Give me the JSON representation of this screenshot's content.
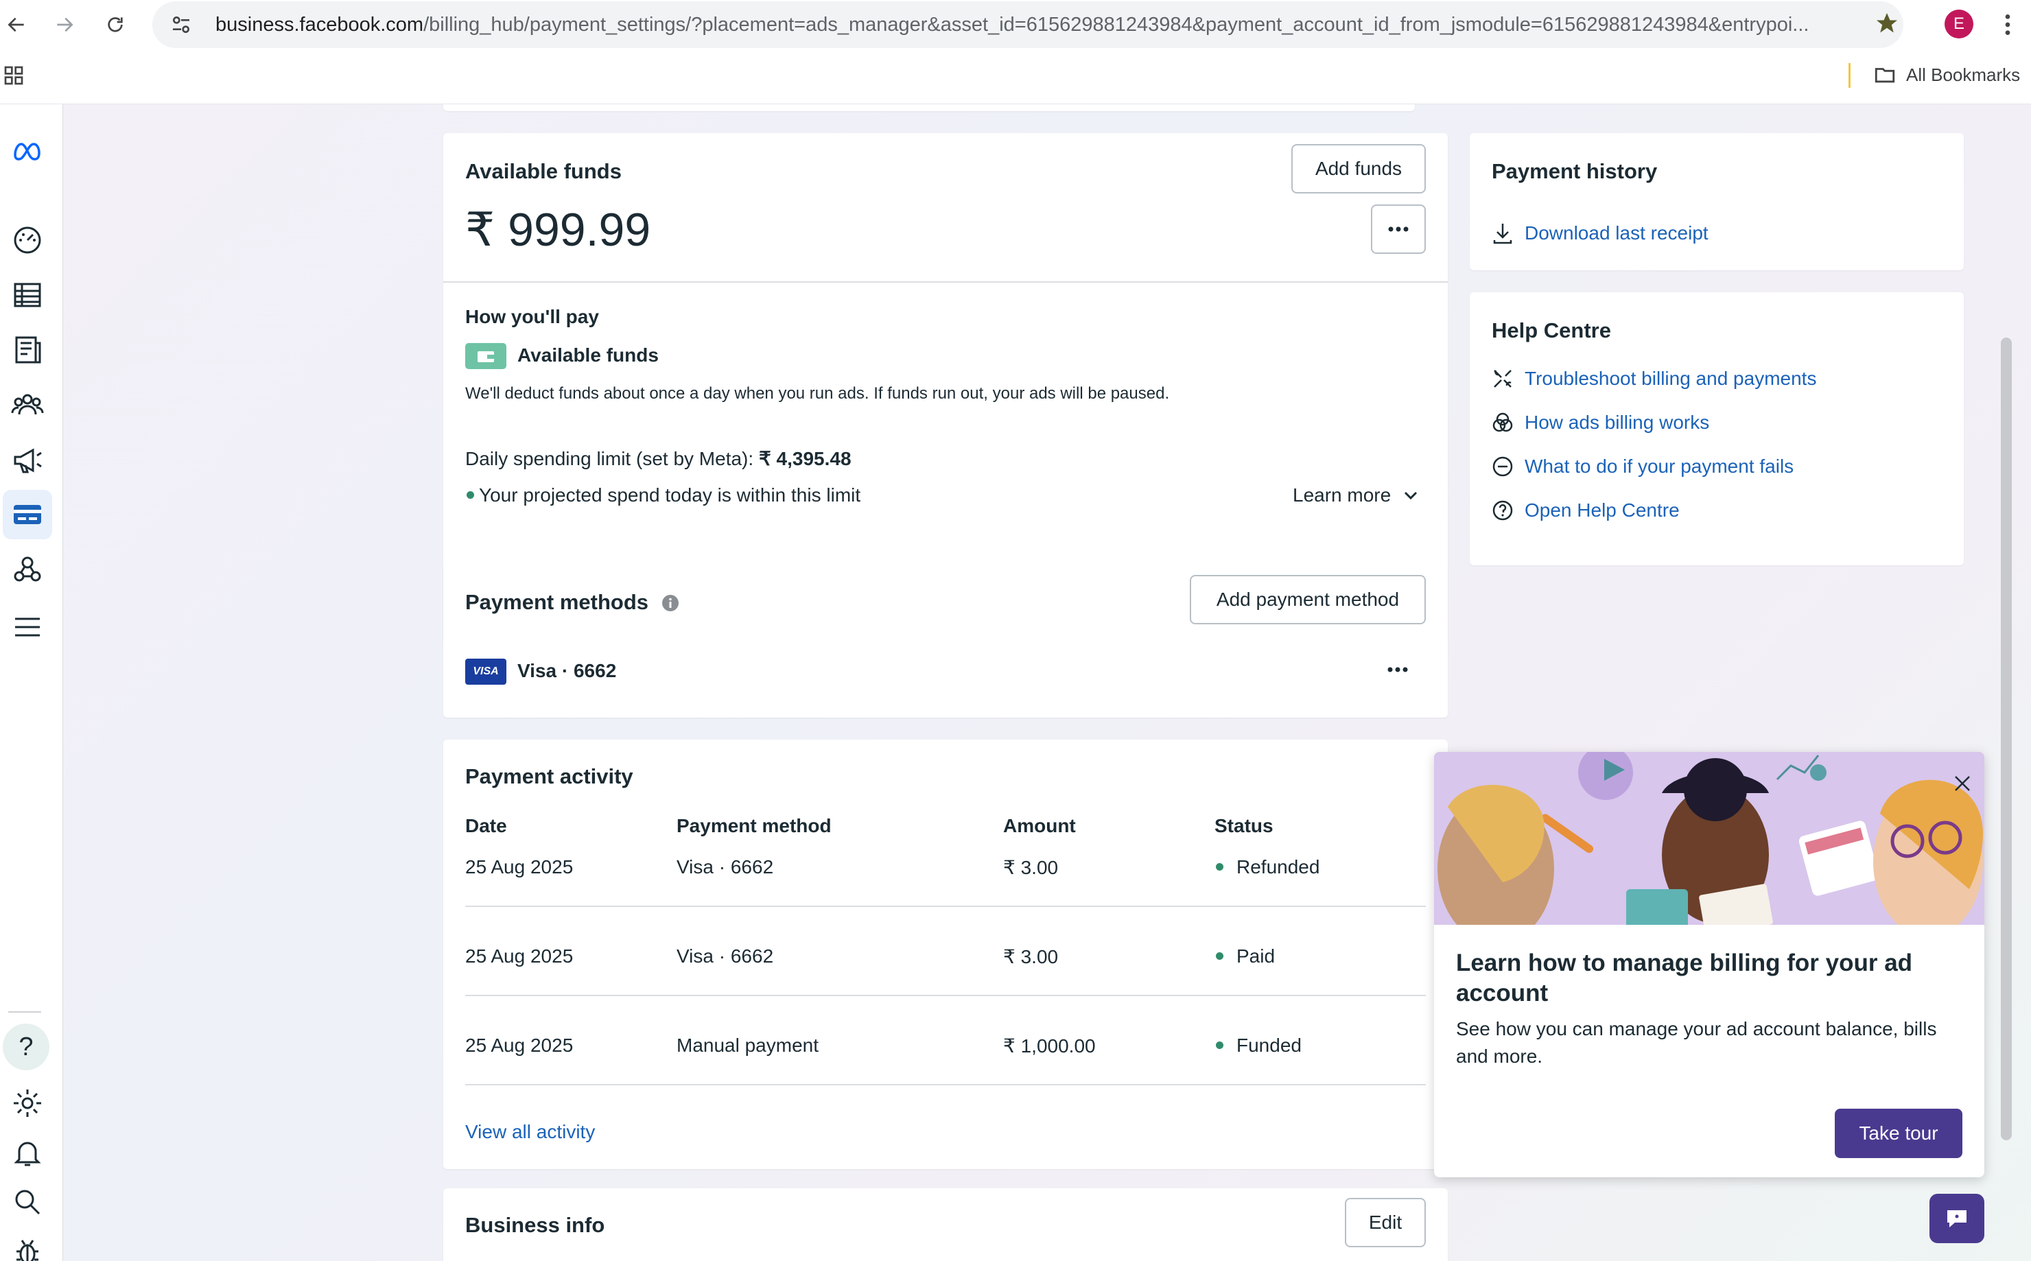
{
  "browser": {
    "url_host": "business.facebook.com",
    "url_path": "/billing_hub/payment_settings/?placement=ads_manager&asset_id=615629881243984&payment_account_id_from_jsmodule=615629881243984&entrypoi...",
    "profile_initial": "E",
    "bookmarks_label": "All Bookmarks"
  },
  "funds": {
    "title": "Available funds",
    "add_funds_label": "Add funds",
    "amount": "₹ 999.99",
    "how_title": "How you'll pay",
    "method_name": "Available funds",
    "description": "We'll deduct funds about once a day when you run ads. If funds run out, your ads will be paused.",
    "limit_label": "Daily spending limit (set by Meta): ",
    "limit_value": "₹ 4,395.48",
    "projection": "Your projected spend today is within this limit",
    "learn_more": "Learn more"
  },
  "payment_methods": {
    "title": "Payment methods",
    "add_label": "Add payment method",
    "card_brand": "VISA",
    "card_label": "Visa · 6662"
  },
  "activity": {
    "title": "Payment activity",
    "columns": [
      "Date",
      "Payment method",
      "Amount",
      "Status"
    ],
    "rows": [
      {
        "date": "25 Aug 2025",
        "method": "Visa · 6662",
        "amount": "₹ 3.00",
        "status": "Refunded"
      },
      {
        "date": "25 Aug 2025",
        "method": "Visa · 6662",
        "amount": "₹ 3.00",
        "status": "Paid"
      },
      {
        "date": "25 Aug 2025",
        "method": "Manual payment",
        "amount": "₹ 1,000.00",
        "status": "Funded"
      }
    ],
    "view_all": "View all activity"
  },
  "business": {
    "title": "Business info",
    "edit_label": "Edit"
  },
  "history": {
    "title": "Payment history",
    "download": "Download last receipt"
  },
  "help": {
    "title": "Help Centre",
    "links": [
      "Troubleshoot billing and payments",
      "How ads billing works",
      "What to do if your payment fails",
      "Open Help Centre"
    ]
  },
  "tour": {
    "title": "Learn how to manage billing for your ad account",
    "body": "See how you can manage your ad account balance, bills and more.",
    "button": "Take tour"
  },
  "colors": {
    "link": "#1b62b8",
    "status_dot": "#2f8c6a",
    "primary_button": "#4a3a8f",
    "active_nav": "#e7f0fb"
  }
}
